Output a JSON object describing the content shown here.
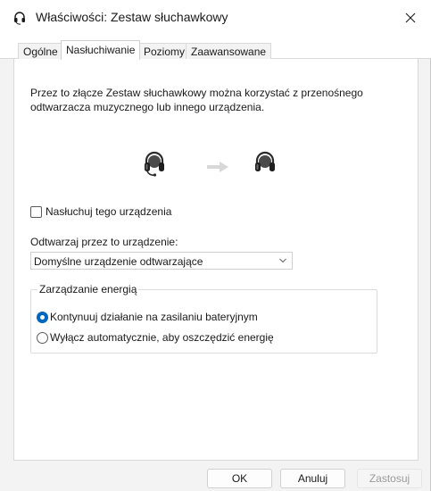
{
  "window": {
    "title": "Właściwości: Zestaw słuchawkowy"
  },
  "tabs": [
    {
      "label": "Ogólne",
      "active": false
    },
    {
      "label": "Nasłuchiwanie",
      "active": true
    },
    {
      "label": "Poziomy",
      "active": false
    },
    {
      "label": "Zaawansowane",
      "active": false
    }
  ],
  "panel": {
    "description_line1": "Przez to złącze Zestaw słuchawkowy można korzystać z przenośnego",
    "description_line2": "odtwarzacza muzycznego lub innego urządzenia.",
    "listen_checkbox_label": "Nasłuchuj tego urządzenia",
    "listen_checked": false,
    "playback_label": "Odtwarzaj przez to urządzenie:",
    "playback_selected": "Domyślne urządzenie odtwarzające",
    "power_group_title": "Zarządzanie energią",
    "power_options": [
      {
        "label": "Kontynuuj działanie na zasilaniu bateryjnym",
        "selected": true
      },
      {
        "label": "Wyłącz automatycznie, aby oszczędzić energię",
        "selected": false
      }
    ]
  },
  "footer": {
    "ok_label": "OK",
    "cancel_label": "Anuluj",
    "apply_label": "Zastosuj",
    "apply_enabled": false
  },
  "colors": {
    "accent": "#0067c0"
  }
}
